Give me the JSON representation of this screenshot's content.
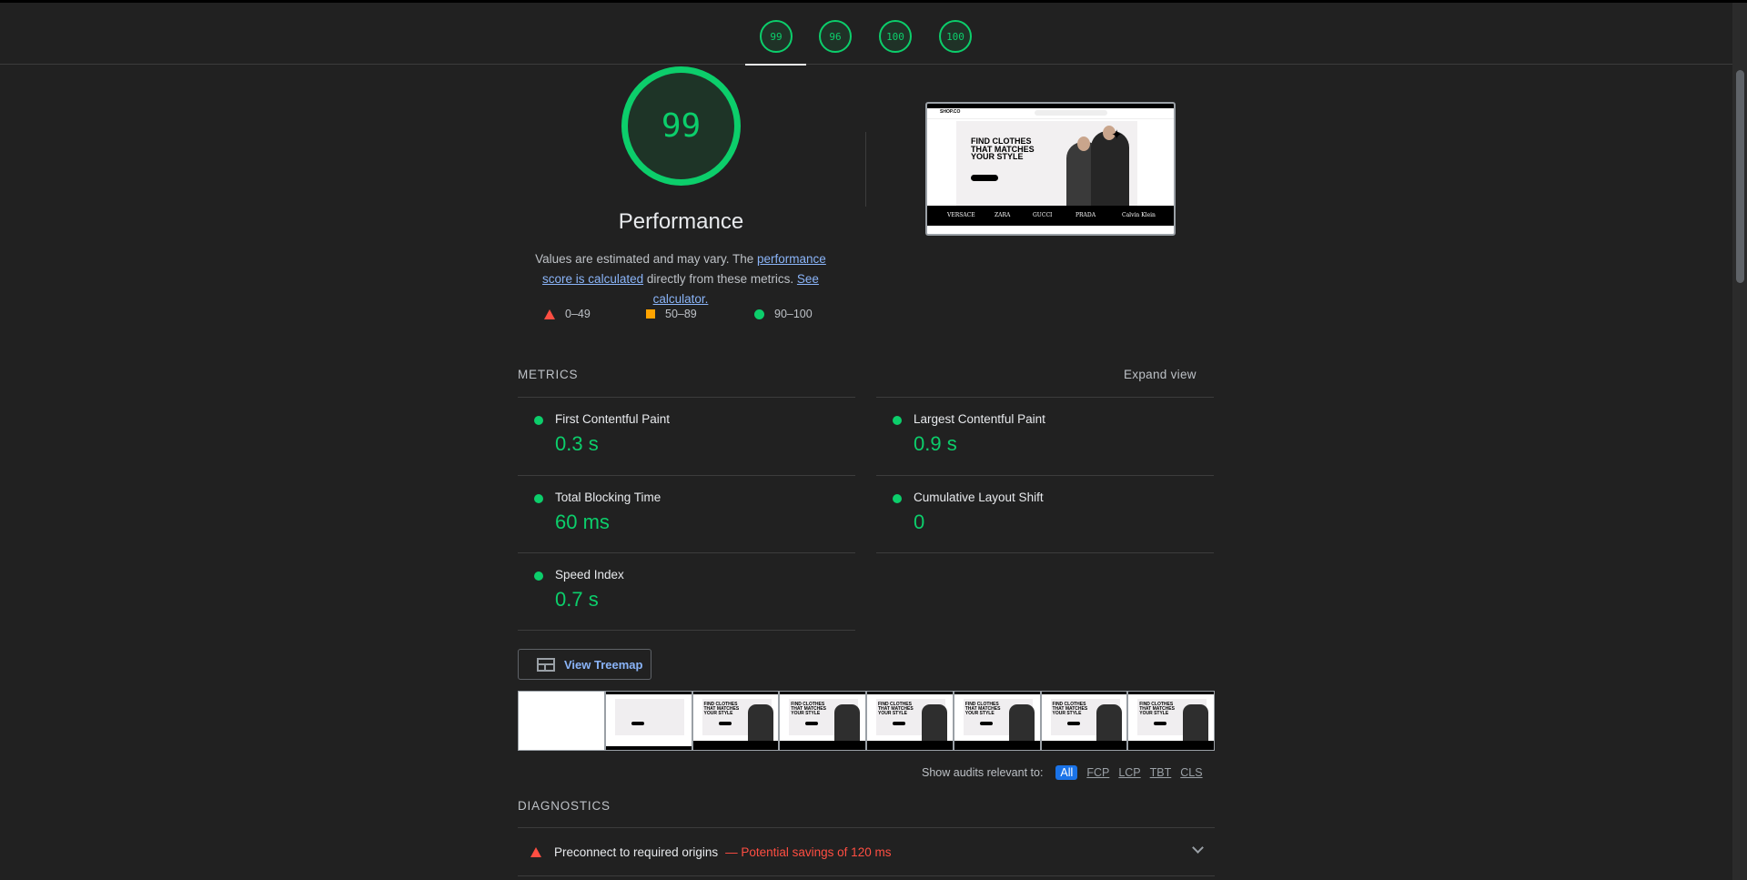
{
  "header": {
    "scores": [
      "99",
      "96",
      "100",
      "100"
    ]
  },
  "performance": {
    "score": "99",
    "title": "Performance",
    "desc_1": "Values are estimated and may vary. The ",
    "link_score": "performance score is calculated",
    "desc_2": " directly from these metrics. ",
    "link_calc": "See calculator.",
    "legend": {
      "fail": "0–49",
      "average": "50–89",
      "pass": "90–100"
    }
  },
  "screenshot": {
    "logo": "SHOP.CO",
    "headline": "FIND CLOTHES THAT MATCHES YOUR STYLE",
    "brands": [
      "VERSACE",
      "ZARA",
      "GUCCI",
      "PRADA",
      "Calvin Klein"
    ]
  },
  "metrics": {
    "section_title": "METRICS",
    "expand": "Expand view",
    "fcp": {
      "label": "First Contentful Paint",
      "value": "0.3 s"
    },
    "lcp": {
      "label": "Largest Contentful Paint",
      "value": "0.9 s"
    },
    "tbt": {
      "label": "Total Blocking Time",
      "value": "60 ms"
    },
    "cls": {
      "label": "Cumulative Layout Shift",
      "value": "0"
    },
    "si": {
      "label": "Speed Index",
      "value": "0.7 s"
    }
  },
  "treemap": {
    "label": "View Treemap"
  },
  "filter": {
    "label": "Show audits relevant to:",
    "chips": [
      "All",
      "FCP",
      "LCP",
      "TBT",
      "CLS"
    ]
  },
  "diagnostics": {
    "title": "DIAGNOSTICS",
    "items": [
      {
        "title": "Preconnect to required origins",
        "savings": "— Potential savings of 120 ms"
      }
    ]
  },
  "colors": {
    "pass": "#0cce6b",
    "average": "#ffa400",
    "fail": "#ff4e42",
    "link": "#8ab4f8",
    "accent": "#1a73e8"
  }
}
